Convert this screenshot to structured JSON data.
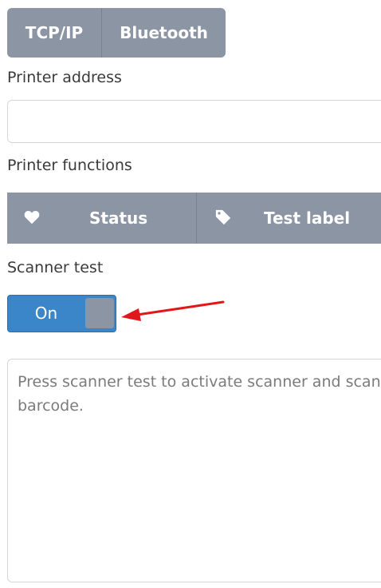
{
  "connection_tabs": {
    "tcpip_label": "TCP/IP",
    "bluetooth_label": "Bluetooth"
  },
  "printer_address": {
    "label": "Printer address",
    "value": "",
    "placeholder": ""
  },
  "printer_functions": {
    "label": "Printer functions",
    "status_label": "Status",
    "status_icon": "heart-icon",
    "test_label": "Test label",
    "test_icon": "tag-icon"
  },
  "scanner_test": {
    "label": "Scanner test",
    "toggle_label": "On",
    "toggle_state": "on",
    "toggle_color": "#3a86c8"
  },
  "output": {
    "placeholder": "Press scanner test to activate scanner and scan barcode."
  },
  "colors": {
    "segment_bg": "#8c95a3",
    "annotation_arrow": "#e0181b"
  }
}
